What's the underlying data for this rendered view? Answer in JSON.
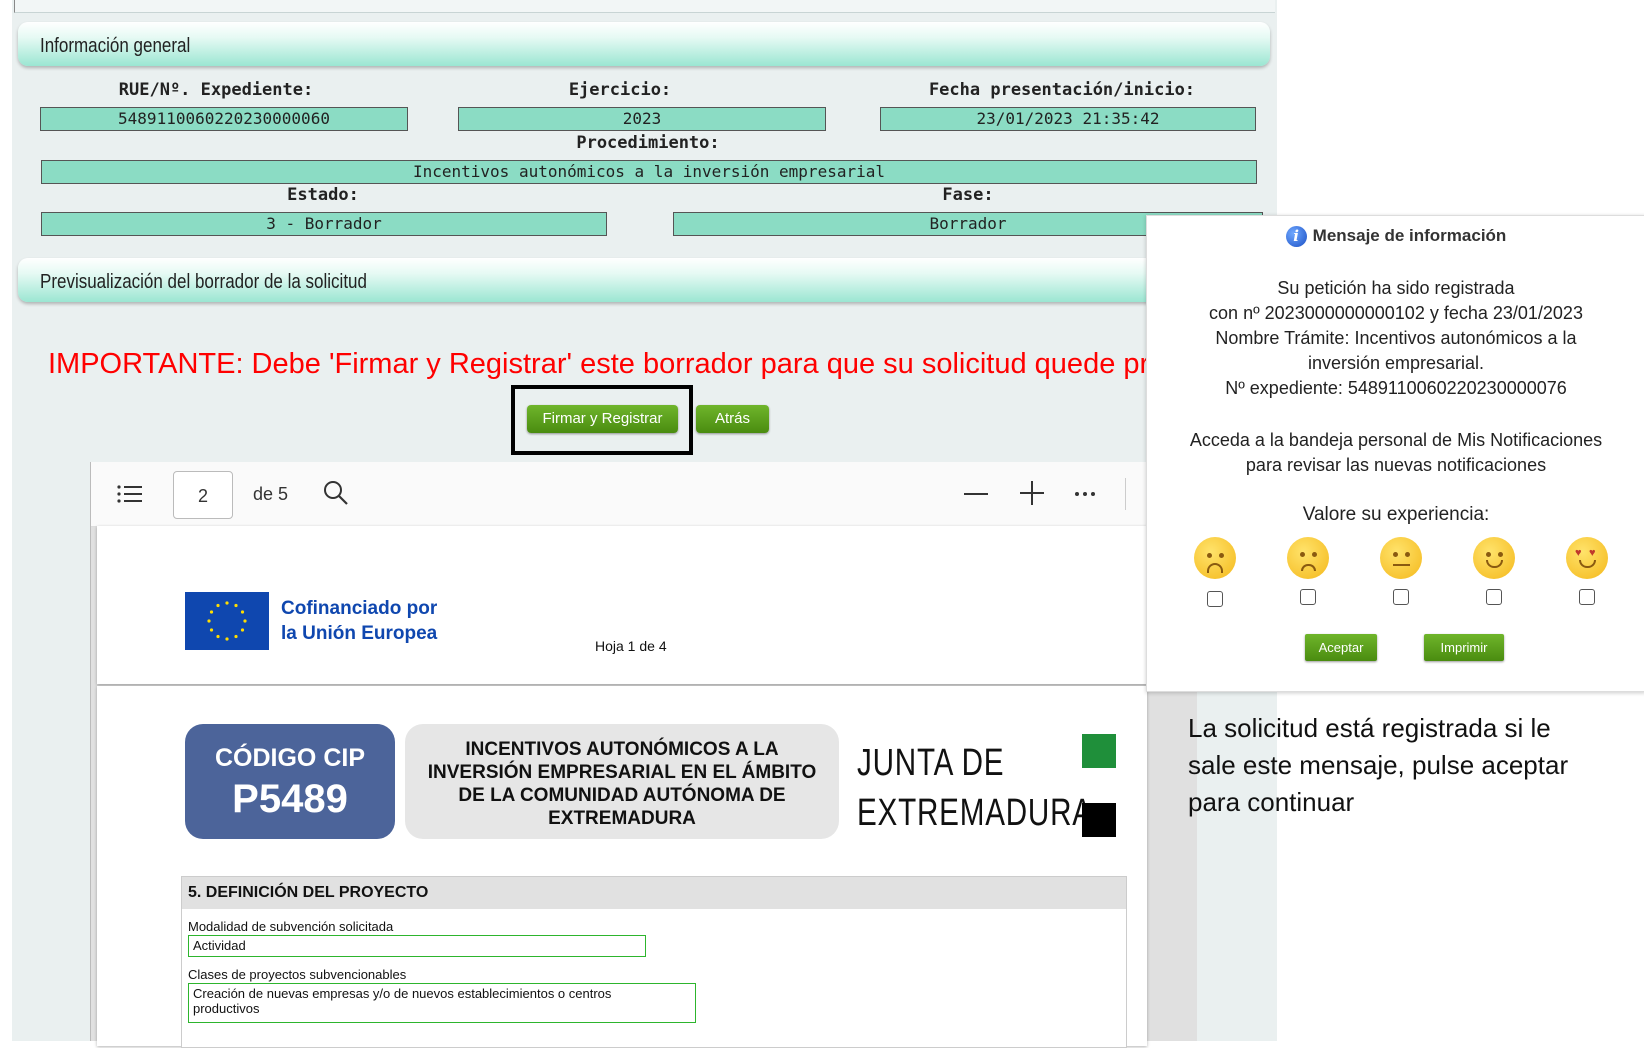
{
  "general": {
    "header": "Información general",
    "rue_label": "RUE/Nº. Expediente:",
    "rue_value": "5489110060220230000060",
    "ejercicio_label": "Ejercicio:",
    "ejercicio_value": "2023",
    "fecha_label": "Fecha presentación/inicio:",
    "fecha_value": "23/01/2023 21:35:42",
    "procedimiento_label": "Procedimiento:",
    "procedimiento_value": "Incentivos autonómicos a la inversión empresarial",
    "estado_label": "Estado:",
    "estado_value": "3 - Borrador",
    "fase_label": "Fase:",
    "fase_value": "Borrador"
  },
  "preview": {
    "header": "Previsualización del borrador de la solicitud",
    "important": "IMPORTANTE: Debe 'Firmar y Registrar' este borrador para que su solicitud quede pres",
    "sign_button": "Firmar y Registrar",
    "back_button": "Atrás"
  },
  "viewer": {
    "page_current": "2",
    "page_total": "de 5"
  },
  "pdf": {
    "cofinanciado_line1": "Cofinanciado por",
    "cofinanciado_line2": "la Unión Europea",
    "hoja": "Hoja 1 de 4",
    "cip_label": "CÓDIGO CIP",
    "cip_code": "P5489",
    "title_line1": "INCENTIVOS AUTONÓMICOS A LA",
    "title_line2": "INVERSIÓN EMPRESARIAL EN EL ÁMBITO",
    "title_line3": "DE LA COMUNIDAD AUTÓNOMA DE",
    "title_line4": "EXTREMADURA",
    "junta_line1": "JUNTA DE",
    "junta_line2": "EXTREMADURA",
    "section5_title": "5. DEFINICIÓN DEL PROYECTO",
    "modalidad_label": "Modalidad de subvención solicitada",
    "modalidad_value": "Actividad",
    "clases_label": "Clases de proyectos subvencionables",
    "clases_value_line1": "Creación de nuevas empresas y/o de nuevos establecimientos o centros",
    "clases_value_line2": "productivos"
  },
  "dialog": {
    "title": "Mensaje de información",
    "line1": "Su petición ha sido registrada",
    "line2": "con nº 2023000000000102 y fecha 23/01/2023",
    "line3": "Nombre Trámite: Incentivos autonómicos a la",
    "line4": "inversión empresarial.",
    "line5": "Nº expediente: 5489110060220230000076",
    "line6": "Acceda a la bandeja personal de Mis Notificaciones",
    "line7": "para revisar las nuevas notificaciones",
    "rate_label": "Valore su experiencia:",
    "accept_button": "Aceptar",
    "print_button": "Imprimir"
  },
  "note": {
    "line1": "La solicitud está registrada si le",
    "line2": "sale este mensaje, pulse aceptar",
    "line3": "para continuar"
  },
  "colors": {
    "field_bg": "#8bdcc4",
    "important_red": "#ff0000",
    "button_green": "#5a9f1c",
    "eu_blue": "#0f47af",
    "cip_blue": "#4c649a"
  }
}
